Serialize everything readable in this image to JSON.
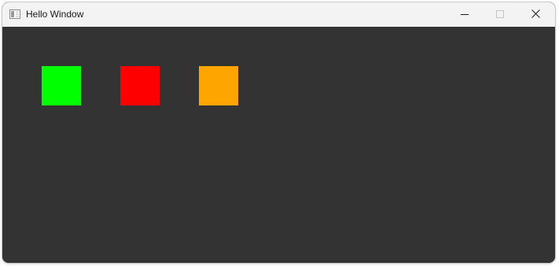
{
  "window": {
    "title": "Hello Window",
    "titlebar_bg": "#f3f3f3",
    "client_bg": "#333333",
    "icons": {
      "app": "app-window-icon",
      "minimize": "minimize-icon",
      "maximize": "maximize-icon",
      "close": "close-icon"
    },
    "maximize_disabled": true
  },
  "squares": [
    {
      "color": "#00ff00"
    },
    {
      "color": "#ff0000"
    },
    {
      "color": "#ffa500"
    }
  ]
}
